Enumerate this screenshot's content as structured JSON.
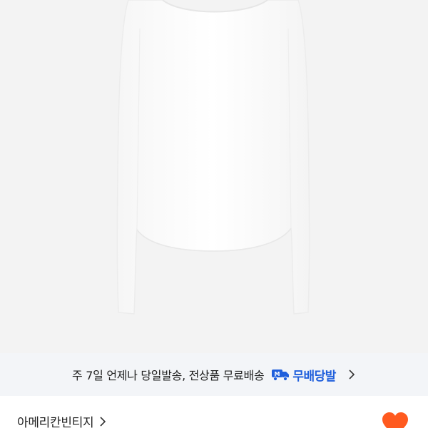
{
  "product": {
    "image_alt": "white long sleeve top"
  },
  "shipping": {
    "text": "주 7일 언제나 당일발송, 전상품 무료배송",
    "badge_label": "무배당발",
    "badge_icon": "delivery-truck-icon",
    "accent_color": "#1f5fdc"
  },
  "seller": {
    "name": "아메리칸빈티지",
    "icon": "chevron-right-icon"
  },
  "like": {
    "icon": "heart-icon",
    "color": "#ff5a1f"
  }
}
